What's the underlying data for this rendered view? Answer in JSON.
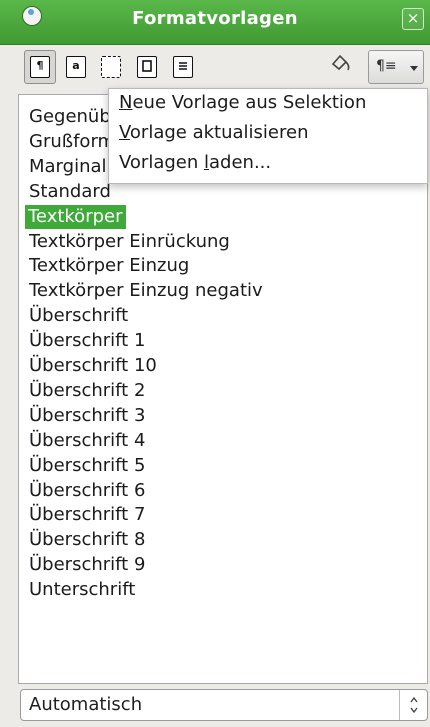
{
  "window": {
    "title": "Formatvorlagen",
    "close_label": "×"
  },
  "toolbar": {
    "buttons": [
      {
        "label": "¶",
        "name": "paragraph-styles-button"
      },
      {
        "label": "a",
        "name": "character-styles-button"
      },
      {
        "label": "",
        "name": "frame-styles-button"
      },
      {
        "label": "",
        "name": "page-styles-button"
      },
      {
        "label": "",
        "name": "list-styles-button"
      }
    ],
    "fill_icon": "fill-format-icon",
    "new_style_label": "¶≡"
  },
  "styles": [
    "Gegenüber",
    "Grußformel",
    "Marginalie",
    "Standard",
    "Textkörper",
    "Textkörper Einrückung",
    "Textkörper Einzug",
    "Textkörper Einzug negativ",
    "Überschrift",
    "Überschrift 1",
    "Überschrift 10",
    "Überschrift 2",
    "Überschrift 3",
    "Überschrift 4",
    "Überschrift 5",
    "Überschrift 6",
    "Überschrift 7",
    "Überschrift 8",
    "Überschrift 9",
    "Unterschrift"
  ],
  "selected_style": "Textkörper",
  "menu": {
    "items": [
      {
        "pre": "",
        "u": "N",
        "post": "eue Vorlage aus Selektion"
      },
      {
        "pre": "",
        "u": "V",
        "post": "orlage aktualisieren"
      },
      {
        "pre": "Vorlagen ",
        "u": "l",
        "post": "aden..."
      }
    ]
  },
  "filter": {
    "value": "Automatisch",
    "spin": "▴▾"
  },
  "colors": {
    "accent": "#3faa3a",
    "titlebar": "#4aa93c"
  }
}
